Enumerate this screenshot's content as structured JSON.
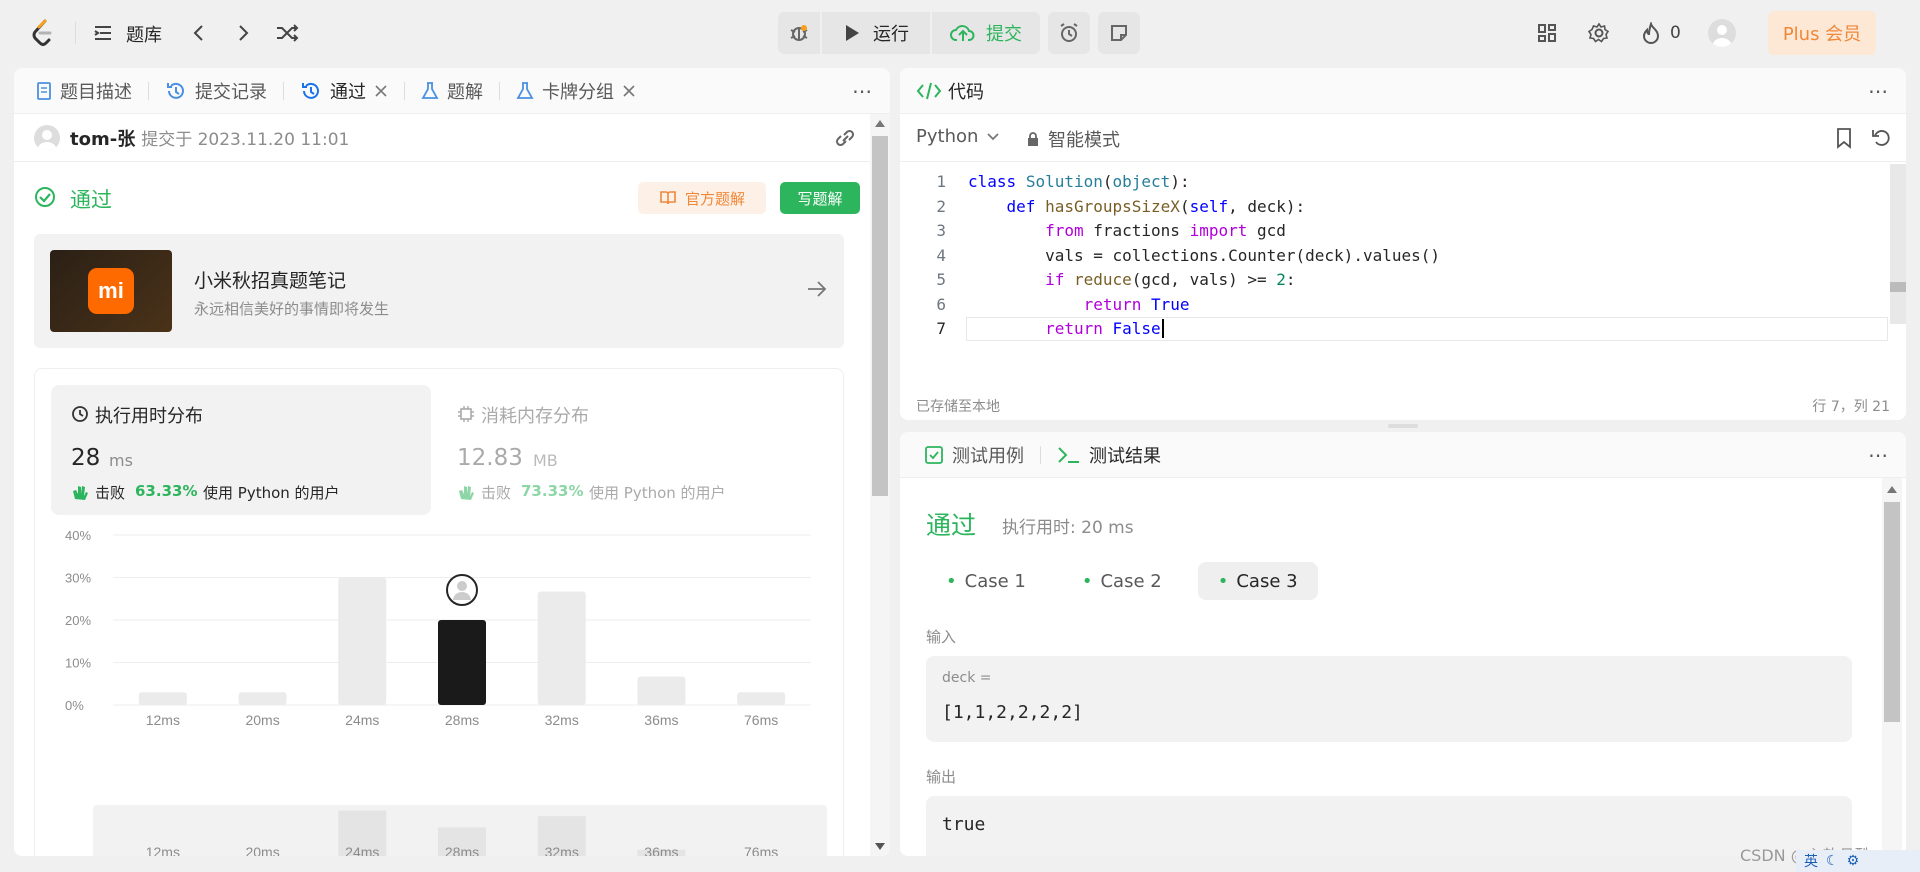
{
  "topbar": {
    "problems_label": "题库",
    "run_label": "运行",
    "submit_label": "提交",
    "fire_count": "0",
    "plus_label": "Plus 会员"
  },
  "left": {
    "tabs": [
      {
        "label": "题目描述"
      },
      {
        "label": "提交记录"
      },
      {
        "label": "通过"
      },
      {
        "label": "题解"
      },
      {
        "label": "卡牌分组"
      }
    ],
    "user": "tom-张",
    "submitted_at": "提交于 2023.11.20 11:01",
    "status": "通过",
    "official_label": "官方题解",
    "write_label": "写题解",
    "ad": {
      "title": "小米秋招真题笔记",
      "subtitle": "永远相信美好的事情即将发生",
      "logo": "mi"
    },
    "runtime": {
      "title": "执行用时分布",
      "value": "28",
      "unit": "ms",
      "beat_prefix": "击败",
      "beat": "63.33%",
      "beat_suffix": "使用 Python 的用户"
    },
    "memory": {
      "title": "消耗内存分布",
      "value": "12.83",
      "unit": "MB",
      "beat_prefix": "击败",
      "beat": "73.33%",
      "beat_suffix": "使用 Python 的用户"
    }
  },
  "chart_data": {
    "type": "bar",
    "categories": [
      "12ms",
      "20ms",
      "24ms",
      "28ms",
      "32ms",
      "36ms",
      "76ms"
    ],
    "values": [
      3,
      3,
      30,
      20,
      26.7,
      6.7,
      3
    ],
    "highlight": "28ms",
    "yticks": [
      "40%",
      "30%",
      "20%",
      "10%",
      "0%"
    ],
    "ylim": [
      0,
      40
    ],
    "mini_categories": [
      "12ms",
      "20ms",
      "24ms",
      "28ms",
      "32ms",
      "36ms",
      "76ms"
    ],
    "colors": {
      "bar": "#ebebeb",
      "highlight": "#1a1a1a",
      "grid": "#eeeeee"
    }
  },
  "code": {
    "title": "代码",
    "language": "Python",
    "mode": "智能模式",
    "saved": "已存储至本地",
    "cursor": "行 7，列 21",
    "line_numbers": [
      "1",
      "2",
      "3",
      "4",
      "5",
      "6",
      "7"
    ]
  },
  "test": {
    "tab_cases": "测试用例",
    "tab_result": "测试结果",
    "status": "通过",
    "runtime": "执行用时: 20 ms",
    "cases": [
      "Case 1",
      "Case 2",
      "Case 3"
    ],
    "input_label": "输入",
    "input_var": "deck =",
    "input_value": "[1,1,2,2,2,2]",
    "output_label": "输出",
    "output_value": "true"
  },
  "watermark": "CSDN @心软且酷",
  "ime": "英"
}
